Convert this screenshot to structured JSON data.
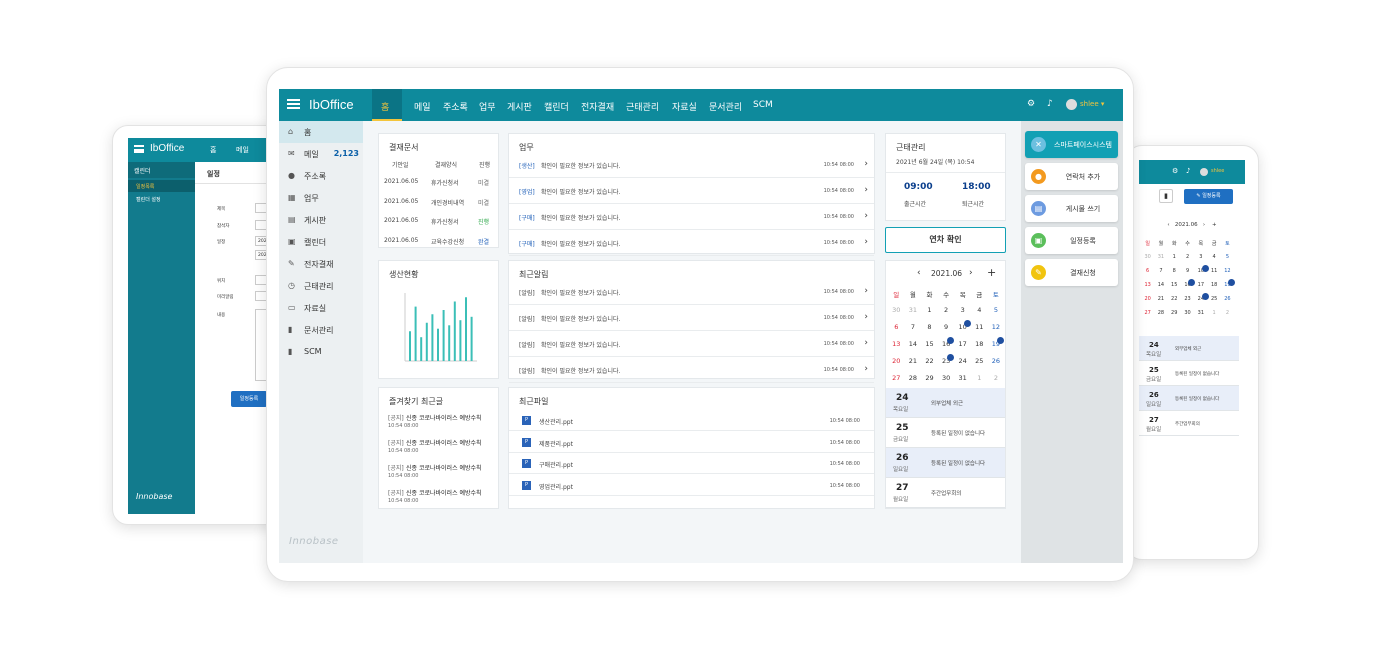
{
  "brand": {
    "name": "IbOffice",
    "logo_text": "Innobase"
  },
  "nav": [
    "홈",
    "메일",
    "주소록",
    "업무",
    "게시판",
    "캘린더",
    "전자결재",
    "근태관리",
    "자료실",
    "문서관리",
    "SCM"
  ],
  "user": {
    "name": "shlee"
  },
  "sidebar": [
    {
      "label": "홈",
      "icon": "home-icon",
      "glyph": "⌂"
    },
    {
      "label": "메일",
      "icon": "mail-icon",
      "glyph": "✉",
      "count": "2,123"
    },
    {
      "label": "주소록",
      "icon": "person-icon",
      "glyph": "●"
    },
    {
      "label": "업무",
      "icon": "grid-icon",
      "glyph": "▦"
    },
    {
      "label": "게시판",
      "icon": "board-icon",
      "glyph": "▤"
    },
    {
      "label": "캘린더",
      "icon": "calendar-icon",
      "glyph": "▣"
    },
    {
      "label": "전자결재",
      "icon": "pen-icon",
      "glyph": "✎"
    },
    {
      "label": "근태관리",
      "icon": "clock-icon",
      "glyph": "◷"
    },
    {
      "label": "자료실",
      "icon": "folder-icon",
      "glyph": "▭"
    },
    {
      "label": "문서관리",
      "icon": "document-icon",
      "glyph": "▮"
    },
    {
      "label": "SCM",
      "icon": "document-icon",
      "glyph": "▮"
    }
  ],
  "approval": {
    "title": "결재문서",
    "headers": [
      "기안일",
      "결재양식",
      "진행"
    ],
    "rows": [
      {
        "date": "2021.06.05",
        "form": "휴가신청서",
        "status": "미결",
        "color": "#666666"
      },
      {
        "date": "2021.06.05",
        "form": "개인경비내역",
        "status": "미결",
        "color": "#666666"
      },
      {
        "date": "2021.06.05",
        "form": "휴가신청서",
        "status": "진행",
        "color": "#2ea84a"
      },
      {
        "date": "2021.06.05",
        "form": "교육수강신청",
        "status": "완결",
        "color": "#1f5fb8"
      }
    ]
  },
  "tasks": {
    "title": "업무",
    "rows": [
      {
        "tag": "[생산]",
        "text": "확인이 필요한 정보가 있습니다.",
        "time": "10:54 08:00"
      },
      {
        "tag": "[영업]",
        "text": "확인이 필요한 정보가 있습니다.",
        "time": "10:54 08:00"
      },
      {
        "tag": "[구매]",
        "text": "확인이 필요한 정보가 있습니다.",
        "time": "10:54 08:00"
      },
      {
        "tag": "[구매]",
        "text": "확인이 필요한 정보가 있습니다.",
        "time": "10:54 08:00"
      }
    ]
  },
  "attendance": {
    "title": "근태관리",
    "date": "2021년 6월 24일 (목) 10:54",
    "in_time": "09:00",
    "in_label": "출근시간",
    "out_time": "18:00",
    "out_label": "퇴근시간",
    "vacation_button": "연차 확인"
  },
  "production": {
    "title": "생산현황"
  },
  "chart_data": {
    "type": "bar",
    "title": "생산현황",
    "ylim": [
      0,
      80
    ],
    "values": [
      35,
      64,
      28,
      45,
      55,
      38,
      60,
      42,
      70,
      48,
      75,
      52
    ],
    "color": "#3bbfb7"
  },
  "notices": {
    "title": "최근알림",
    "rows": [
      {
        "tag": "[알림]",
        "text": "확인이 필요한 정보가 있습니다.",
        "time": "10:54 08:00"
      },
      {
        "tag": "[알림]",
        "text": "확인이 필요한 정보가 있습니다.",
        "time": "10:54 08:00"
      },
      {
        "tag": "[알림]",
        "text": "확인이 필요한 정보가 있습니다.",
        "time": "10:54 08:00"
      },
      {
        "tag": "[알림]",
        "text": "확인이 필요한 정보가 있습니다.",
        "time": "10:54 08:00"
      }
    ]
  },
  "favorites": {
    "title": "즐겨찾기 최근글",
    "rows": [
      {
        "tag": "[공지]",
        "text": "신종 코로나바이러스 예방수칙",
        "time": "10:54 08:00"
      },
      {
        "tag": "[공지]",
        "text": "신종 코로나바이러스 예방수칙",
        "time": "10:54 08:00"
      },
      {
        "tag": "[공지]",
        "text": "신종 코로나바이러스 예방수칙",
        "time": "10:54 08:00"
      },
      {
        "tag": "[공지]",
        "text": "신종 코로나바이러스 예방수칙",
        "time": "10:54 08:00"
      }
    ]
  },
  "files": {
    "title": "최근파일",
    "rows": [
      {
        "name": "생산관리.ppt",
        "time": "10:54 08:00"
      },
      {
        "name": "제품관리.ppt",
        "time": "10:54 08:00"
      },
      {
        "name": "구매관리.ppt",
        "time": "10:54 08:00"
      },
      {
        "name": "영업관리.ppt",
        "time": "10:54 08:00"
      }
    ]
  },
  "calendar": {
    "month": "2021.06",
    "weekdays": [
      "일",
      "월",
      "화",
      "수",
      "목",
      "금",
      "토"
    ],
    "weeks": [
      [
        "30",
        "31",
        "1",
        "2",
        "3",
        "4",
        "5"
      ],
      [
        "6",
        "7",
        "8",
        "9",
        "10",
        "11",
        "12"
      ],
      [
        "13",
        "14",
        "15",
        "16",
        "17",
        "18",
        "19"
      ],
      [
        "20",
        "21",
        "22",
        "23",
        "24",
        "25",
        "26"
      ],
      [
        "27",
        "28",
        "29",
        "30",
        "31",
        "1",
        "2"
      ]
    ],
    "events": [
      {
        "day": "24",
        "weekday": "목요일",
        "text": "외부업체 외근"
      },
      {
        "day": "25",
        "weekday": "금요일",
        "text": "등록된 일정이 없습니다"
      },
      {
        "day": "26",
        "weekday": "일요일",
        "text": "등록된 일정이 없습니다"
      },
      {
        "day": "27",
        "weekday": "월요일",
        "text": "주간업무회의"
      }
    ]
  },
  "quick": [
    {
      "label": "스마트페이스시스템",
      "color": "#6cc0e0",
      "glyph": "✕"
    },
    {
      "label": "연락처 추가",
      "color": "#f39a1f",
      "glyph": "●"
    },
    {
      "label": "게시물 쓰기",
      "color": "#6d9be0",
      "glyph": "▤"
    },
    {
      "label": "일정등록",
      "color": "#5bbf5b",
      "glyph": "▣"
    },
    {
      "label": "결재신청",
      "color": "#f1c40f",
      "glyph": "✎"
    }
  ],
  "left_screen": {
    "brand": "IbOffice",
    "nav": [
      "홈",
      "메일"
    ],
    "section": "캘린더",
    "menu": [
      "일정목록",
      "캘린더 설정"
    ],
    "title": "일정",
    "fields": [
      "제목",
      "참석자",
      "일정",
      "위치",
      "미리알림",
      "내용"
    ],
    "date_value": "202",
    "submit": "일정등록",
    "logo": "Innobase"
  },
  "right_screen": {
    "user": "shlee",
    "add_button": "일정등록",
    "month": "2021.06",
    "weekdays": [
      "일",
      "월",
      "화",
      "수",
      "목",
      "금",
      "토"
    ],
    "weeks": [
      [
        "30",
        "31",
        "1",
        "2",
        "3",
        "4",
        "5"
      ],
      [
        "6",
        "7",
        "8",
        "9",
        "10",
        "11",
        "12"
      ],
      [
        "13",
        "14",
        "15",
        "16",
        "17",
        "18",
        "19"
      ],
      [
        "20",
        "21",
        "22",
        "23",
        "24",
        "25",
        "26"
      ],
      [
        "27",
        "28",
        "29",
        "30",
        "31",
        "1",
        "2"
      ]
    ],
    "events": [
      {
        "day": "24",
        "weekday": "목요일",
        "text": "외부업체 외근"
      },
      {
        "day": "25",
        "weekday": "금요일",
        "text": "등록된 일정이 없습니다"
      },
      {
        "day": "26",
        "weekday": "일요일",
        "text": "등록된 일정이 없습니다"
      },
      {
        "day": "27",
        "weekday": "월요일",
        "text": "주간업무회의"
      }
    ]
  }
}
